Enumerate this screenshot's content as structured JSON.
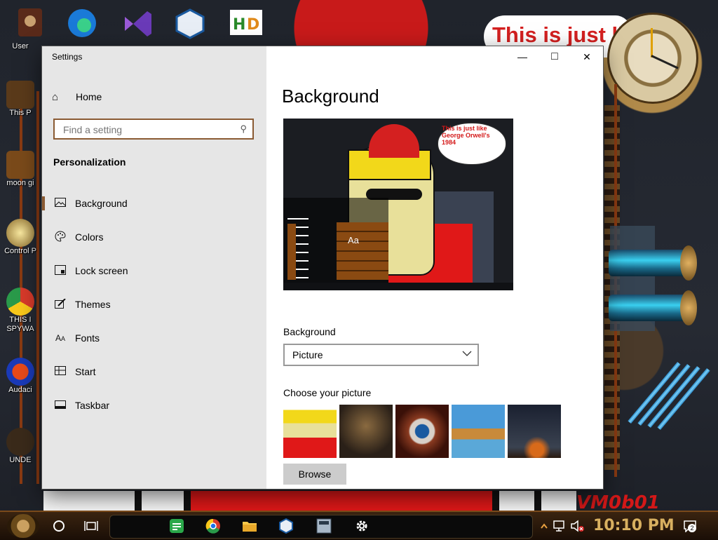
{
  "desktop": {
    "banner_text": "This is just like",
    "watermark": "VM0b01",
    "icons": [
      {
        "label": "User"
      },
      {
        "label": "This P"
      },
      {
        "label": "moon gi"
      },
      {
        "label": "Control P"
      },
      {
        "label": "THIS I SPYWA"
      },
      {
        "label": "Audaci"
      },
      {
        "label": "UNDE"
      }
    ]
  },
  "window": {
    "title": "Settings",
    "minimize_glyph": "—",
    "maximize_glyph": "□",
    "close_glyph": "✕"
  },
  "sidebar": {
    "home_label": "Home",
    "search_placeholder": "Find a setting",
    "section_heading": "Personalization",
    "items": [
      {
        "label": "Background",
        "icon": "image-icon",
        "selected": true
      },
      {
        "label": "Colors",
        "icon": "palette-icon",
        "selected": false
      },
      {
        "label": "Lock screen",
        "icon": "lock-screen-icon",
        "selected": false
      },
      {
        "label": "Themes",
        "icon": "brush-icon",
        "selected": false
      },
      {
        "label": "Fonts",
        "icon": "font-icon",
        "selected": false
      },
      {
        "label": "Start",
        "icon": "start-icon",
        "selected": false
      },
      {
        "label": "Taskbar",
        "icon": "taskbar-icon",
        "selected": false
      }
    ]
  },
  "main": {
    "title": "Background",
    "preview": {
      "bubble_text": "This is just like George Orwell's 1984",
      "sample_text": "Aa"
    },
    "background_label": "Background",
    "background_value": "Picture",
    "choose_label": "Choose your picture",
    "browse_label": "Browse"
  },
  "taskbar": {
    "time": "10:10 PM",
    "notification_count": "2"
  },
  "colors": {
    "accent": "#8a5a32",
    "sidebar_bg": "#e6e6e6",
    "clock_color": "#d8b060"
  }
}
